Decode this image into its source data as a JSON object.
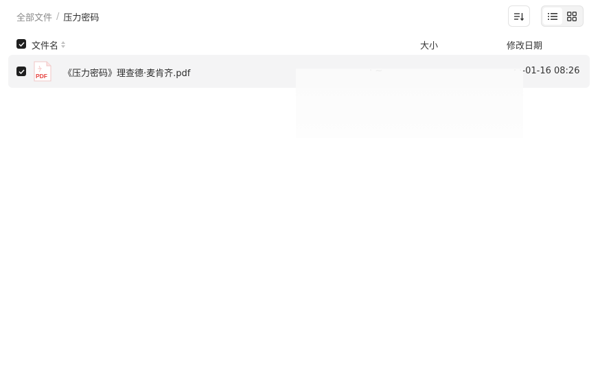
{
  "breadcrumb": {
    "root": "全部文件",
    "separator": "/",
    "current": "压力密码"
  },
  "toolbar": {
    "sort_icon": "sort-descending-icon",
    "views": [
      {
        "name": "list-view-icon",
        "active": true
      },
      {
        "name": "grid-view-icon",
        "active": false
      }
    ]
  },
  "table": {
    "headers": {
      "name": "文件名",
      "size": "大小",
      "modified": "修改日期"
    },
    "rows": [
      {
        "icon": "pdf-file-icon",
        "icon_label": "PDF",
        "name": "《压力密码》理查德·麦肯齐.pdf",
        "size": "· ~",
        "modified": "· ·-01-16 08:26",
        "selected": true
      }
    ]
  },
  "colors": {
    "pdf": "#e64340",
    "checkbox": "#1f1f1f",
    "row_highlight": "#f4f4f5"
  }
}
